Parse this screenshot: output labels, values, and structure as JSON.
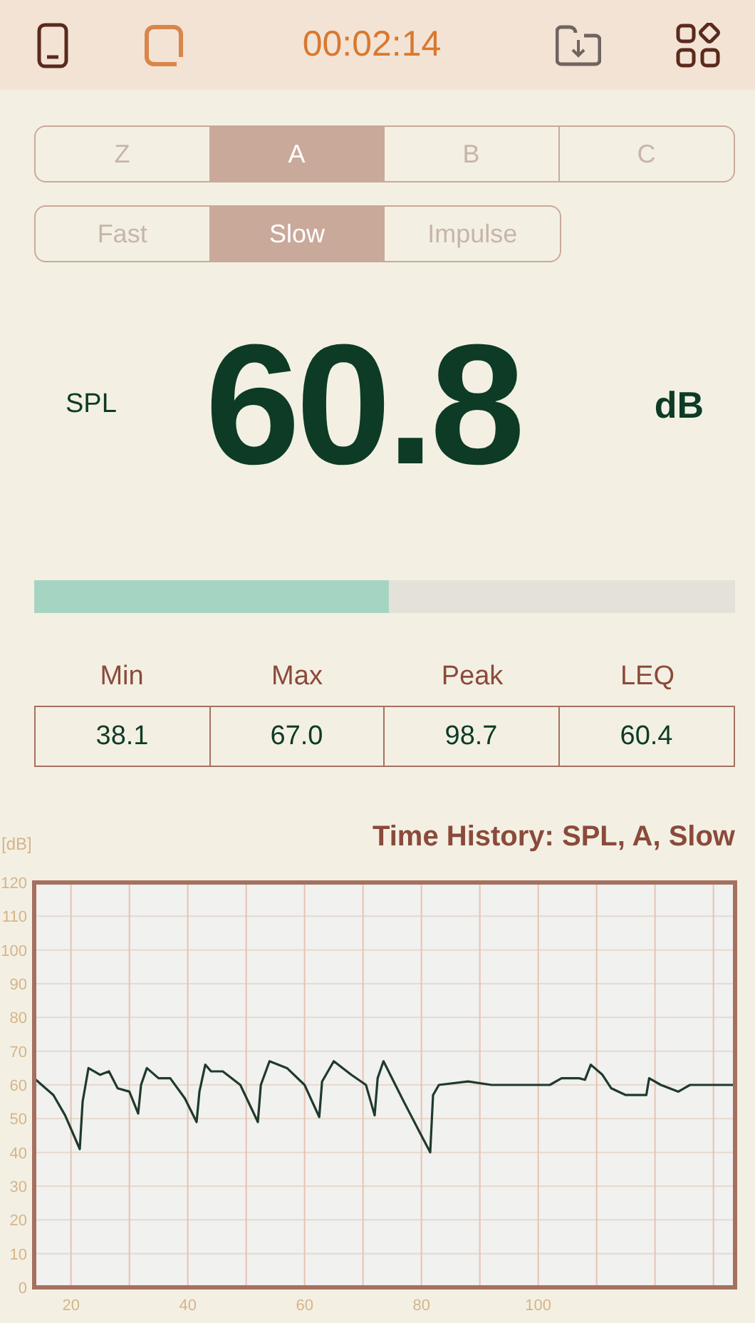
{
  "top_bar": {
    "timer": "00:02:14"
  },
  "weighting_tabs": [
    {
      "label": "Z",
      "selected": false
    },
    {
      "label": "A",
      "selected": true
    },
    {
      "label": "B",
      "selected": false
    },
    {
      "label": "C",
      "selected": false
    }
  ],
  "response_tabs": [
    {
      "label": "Fast",
      "selected": false
    },
    {
      "label": "Slow",
      "selected": true
    },
    {
      "label": "Impulse",
      "selected": false
    }
  ],
  "reading": {
    "label": "SPL",
    "value": "60.8",
    "unit": "dB"
  },
  "level_bar": {
    "level": 0.506
  },
  "stats": [
    {
      "label": "Min",
      "value": "38.1"
    },
    {
      "label": "Max",
      "value": "67.0"
    },
    {
      "label": "Peak",
      "value": "98.7"
    },
    {
      "label": "LEQ",
      "value": "60.4"
    }
  ],
  "time_history": {
    "title": "Time History: SPL, A, Slow",
    "chart_data": {
      "type": "line",
      "grid": true,
      "ylabel": "[dB]",
      "xlim": [
        13.7,
        133.7
      ],
      "ylim": [
        0,
        120
      ],
      "xticks": [
        20,
        40,
        60,
        80,
        100
      ],
      "yticks": [
        0,
        10,
        20,
        30,
        40,
        50,
        60,
        70,
        80,
        90,
        100,
        110,
        120
      ],
      "x": [
        13.7,
        15,
        17,
        19,
        21.5,
        22,
        23,
        25,
        26.5,
        28,
        30,
        31.5,
        32,
        33,
        35,
        37,
        39.5,
        41.5,
        42,
        43,
        44,
        46,
        49,
        52,
        52.5,
        54,
        57,
        60,
        62.5,
        63,
        65,
        68,
        70.5,
        72,
        72.5,
        73.5,
        77,
        80,
        81.5,
        82,
        83,
        88,
        92,
        102,
        104,
        107,
        108,
        109,
        111,
        112.5,
        115,
        118.5,
        119,
        121,
        124,
        126,
        133.7
      ],
      "series": [
        {
          "color": "#1e3a2c",
          "values": [
            62,
            60,
            57,
            51,
            41,
            55,
            65,
            63,
            64,
            59,
            58,
            51.5,
            60,
            65,
            62,
            62,
            56,
            49,
            58,
            66,
            64,
            64,
            60,
            49,
            60,
            67,
            65,
            60,
            50.5,
            61,
            67,
            63,
            60,
            51,
            62,
            67,
            55,
            45,
            40,
            57,
            60,
            61,
            60,
            60,
            62,
            62,
            61.5,
            66,
            63,
            59,
            57,
            57,
            62,
            60,
            58,
            60,
            60
          ]
        }
      ]
    }
  }
}
